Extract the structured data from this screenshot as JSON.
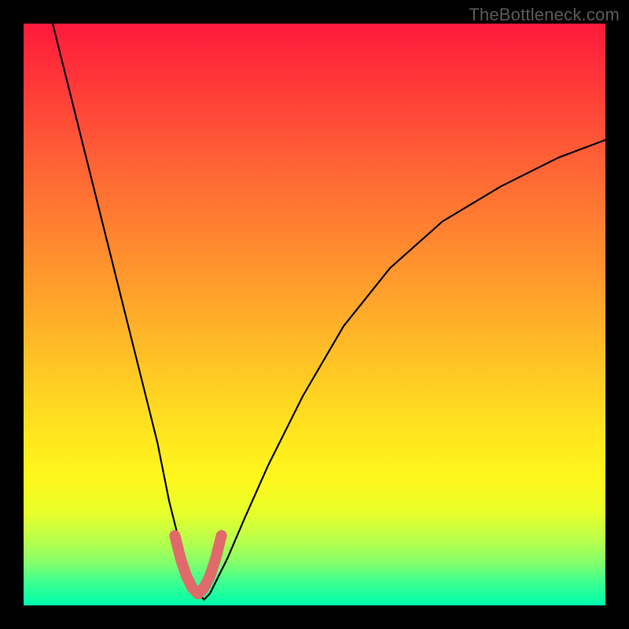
{
  "watermark": "TheBottleneck.com",
  "chart_data": {
    "type": "line",
    "title": "",
    "xlabel": "",
    "ylabel": "",
    "xlim": [
      0,
      100
    ],
    "ylim": [
      0,
      100
    ],
    "grid": false,
    "legend": false,
    "series": [
      {
        "name": "bottleneck-curve",
        "x": [
          5,
          8,
          11,
          14,
          17,
          20,
          23,
          25,
          27,
          29,
          30,
          31,
          32,
          33,
          35,
          38,
          42,
          48,
          55,
          63,
          72,
          82,
          92,
          100
        ],
        "y": [
          100,
          88,
          76,
          64,
          52,
          40,
          28,
          18,
          10,
          4,
          2,
          1,
          2,
          4,
          8,
          15,
          24,
          36,
          48,
          58,
          66,
          72,
          77,
          80
        ]
      },
      {
        "name": "marker-band",
        "x": [
          26,
          27,
          28,
          29,
          30,
          31,
          32,
          33,
          34
        ],
        "y": [
          12,
          8,
          5,
          3,
          2,
          3,
          5,
          8,
          12
        ]
      }
    ]
  }
}
